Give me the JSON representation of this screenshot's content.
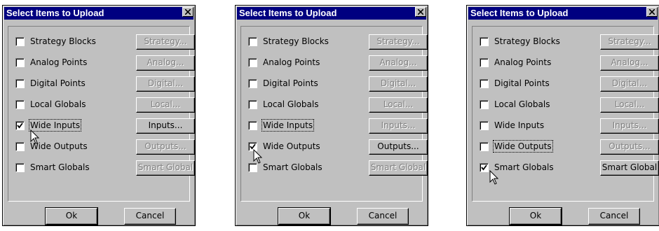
{
  "dialogs": [
    {
      "title": "Select Items to Upload",
      "focus_row": 4,
      "items": [
        {
          "label": "Strategy Blocks",
          "checked": false,
          "button": "Strategy...",
          "button_enabled": false
        },
        {
          "label": "Analog Points",
          "checked": false,
          "button": "Analog...",
          "button_enabled": false
        },
        {
          "label": "Digital Points",
          "checked": false,
          "button": "Digital...",
          "button_enabled": false
        },
        {
          "label": "Local Globals",
          "checked": false,
          "button": "Local...",
          "button_enabled": false
        },
        {
          "label": "Wide Inputs",
          "checked": true,
          "button": "Inputs...",
          "button_enabled": true
        },
        {
          "label": "Wide Outputs",
          "checked": false,
          "button": "Outputs...",
          "button_enabled": false
        },
        {
          "label": "Smart Globals",
          "checked": false,
          "button": "Smart Global",
          "button_enabled": false
        }
      ],
      "ok_label": "Ok",
      "cancel_label": "Cancel"
    },
    {
      "title": "Select Items to Upload",
      "focus_row": 4,
      "items": [
        {
          "label": "Strategy Blocks",
          "checked": false,
          "button": "Strategy...",
          "button_enabled": false
        },
        {
          "label": "Analog Points",
          "checked": false,
          "button": "Analog...",
          "button_enabled": false
        },
        {
          "label": "Digital Points",
          "checked": false,
          "button": "Digital...",
          "button_enabled": false
        },
        {
          "label": "Local Globals",
          "checked": false,
          "button": "Local...",
          "button_enabled": false
        },
        {
          "label": "Wide Inputs",
          "checked": false,
          "button": "Inputs...",
          "button_enabled": false
        },
        {
          "label": "Wide Outputs",
          "checked": true,
          "button": "Outputs...",
          "button_enabled": true
        },
        {
          "label": "Smart Globals",
          "checked": false,
          "button": "Smart Global",
          "button_enabled": false
        }
      ],
      "ok_label": "Ok",
      "cancel_label": "Cancel"
    },
    {
      "title": "Select Items to Upload",
      "focus_row": 5,
      "items": [
        {
          "label": "Strategy Blocks",
          "checked": false,
          "button": "Strategy...",
          "button_enabled": false
        },
        {
          "label": "Analog Points",
          "checked": false,
          "button": "Analog...",
          "button_enabled": false
        },
        {
          "label": "Digital Points",
          "checked": false,
          "button": "Digital...",
          "button_enabled": false
        },
        {
          "label": "Local Globals",
          "checked": false,
          "button": "Local...",
          "button_enabled": false
        },
        {
          "label": "Wide Inputs",
          "checked": false,
          "button": "Inputs...",
          "button_enabled": false
        },
        {
          "label": "Wide Outputs",
          "checked": false,
          "button": "Outputs...",
          "button_enabled": false
        },
        {
          "label": "Smart Globals",
          "checked": true,
          "button": "Smart Global",
          "button_enabled": true
        }
      ],
      "ok_label": "Ok",
      "cancel_label": "Cancel"
    }
  ],
  "icons": {
    "close": "close-icon",
    "check": "checkmark-icon",
    "cursor": "mouse-pointer-icon"
  },
  "colors": {
    "titlebar": "#000080",
    "face": "#c0c0c0",
    "disabled_text": "#808080"
  }
}
